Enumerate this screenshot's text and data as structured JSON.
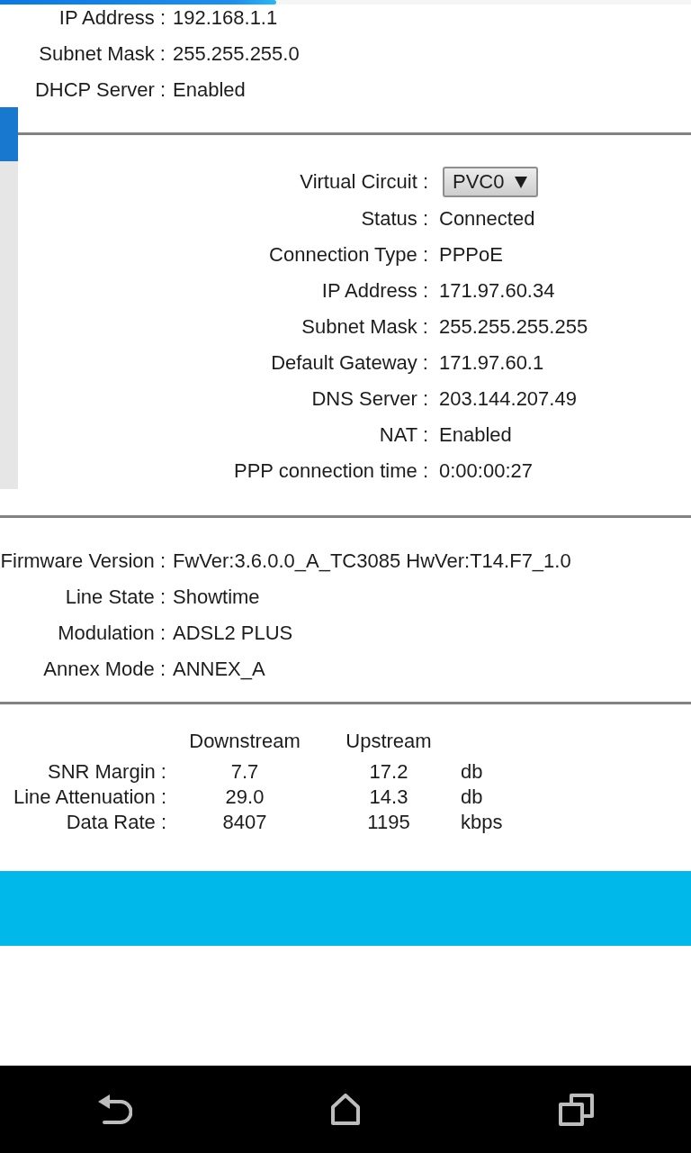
{
  "progress_bar": {
    "level": 0.4
  },
  "lan_info": {
    "rows": [
      {
        "label": "IP Address :",
        "value": "192.168.1.1"
      },
      {
        "label": "Subnet Mask :",
        "value": "255.255.255.0"
      },
      {
        "label": "DHCP Server :",
        "value": "Enabled"
      }
    ]
  },
  "wan_info": {
    "virtual_circuit": {
      "label": "Virtual Circuit :",
      "value": "PVC0"
    },
    "rows": [
      {
        "label": "Status :",
        "value": "Connected"
      },
      {
        "label": "Connection Type :",
        "value": "PPPoE"
      },
      {
        "label": "IP Address :",
        "value": "171.97.60.34"
      },
      {
        "label": "Subnet Mask :",
        "value": "255.255.255.255"
      },
      {
        "label": "Default Gateway :",
        "value": "171.97.60.1"
      },
      {
        "label": "DNS Server :",
        "value": "203.144.207.49"
      },
      {
        "label": "NAT :",
        "value": "Enabled"
      },
      {
        "label": "PPP connection time :",
        "value": "0:00:00:27"
      }
    ]
  },
  "adsl_info": {
    "rows": [
      {
        "label": "Firmware Version :",
        "value": "FwVer:3.6.0.0_A_TC3085 HwVer:T14.F7_1.0"
      },
      {
        "label": "Line State :",
        "value": "Showtime"
      },
      {
        "label": "Modulation :",
        "value": "ADSL2 PLUS"
      },
      {
        "label": "Annex Mode :",
        "value": "ANNEX_A"
      }
    ]
  },
  "line_stats": {
    "columns": [
      "Downstream",
      "Upstream"
    ],
    "rows": [
      {
        "label": "SNR Margin :",
        "downstream": "7.7",
        "upstream": "17.2",
        "unit": "db"
      },
      {
        "label": "Line Attenuation :",
        "downstream": "29.0",
        "upstream": "14.3",
        "unit": "db"
      },
      {
        "label": "Data Rate :",
        "downstream": "8407",
        "upstream": "1195",
        "unit": "kbps"
      }
    ]
  }
}
